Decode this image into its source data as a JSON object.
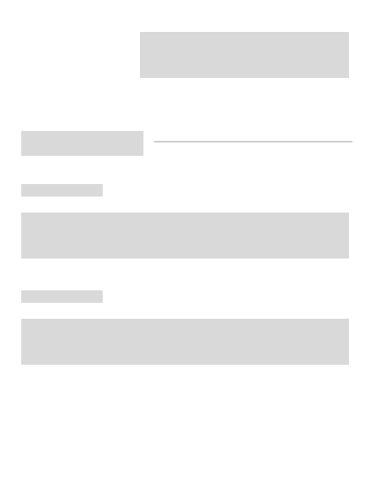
{
  "theme": {
    "placeholder_color": "#d9d9d9",
    "divider_color": "#d0d0d0",
    "background": "#ffffff"
  },
  "header": {
    "banner_text": ""
  },
  "section": {
    "title": ""
  },
  "form": {
    "fields": [
      {
        "label": "",
        "value": ""
      },
      {
        "label": "",
        "value": ""
      }
    ]
  }
}
